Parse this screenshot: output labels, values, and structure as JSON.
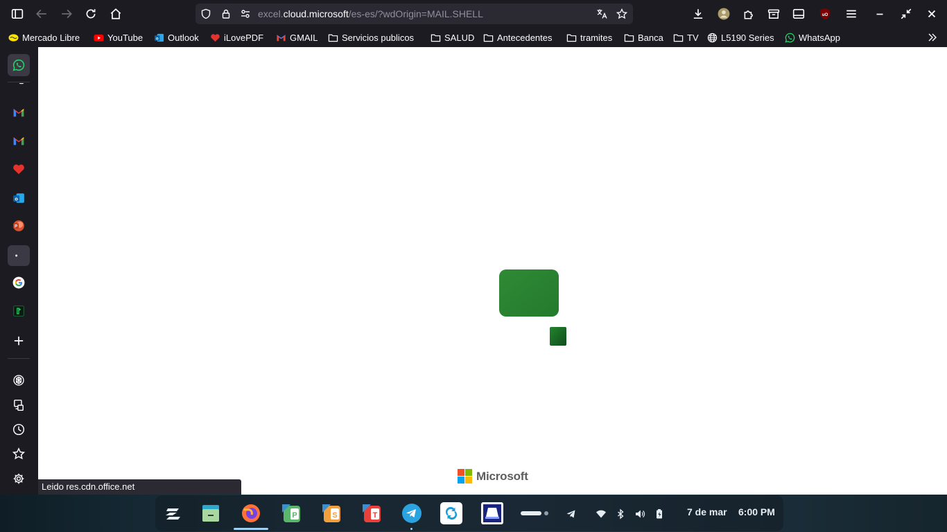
{
  "browser": {
    "url_scheme_host_prefix": "excel.",
    "url_host": "cloud.microsoft",
    "url_path": "/es-es/?wdOrigin=MAIL.SHELL"
  },
  "bookmarks": [
    {
      "label": "Mercado Libre",
      "icon": "mercadolibre-icon"
    },
    {
      "label": "YouTube",
      "icon": "youtube-icon"
    },
    {
      "label": "Outlook",
      "icon": "outlook-icon"
    },
    {
      "label": "iLovePDF",
      "icon": "ilovepdf-icon"
    },
    {
      "label": "GMAIL",
      "icon": "gmail-icon"
    },
    {
      "label": "Servicios publicos",
      "icon": "folder-icon"
    },
    {
      "label": "SALUD",
      "icon": "folder-icon"
    },
    {
      "label": "Antecedentes",
      "icon": "folder-icon"
    },
    {
      "label": "tramites",
      "icon": "folder-icon"
    },
    {
      "label": "Banca",
      "icon": "folder-icon"
    },
    {
      "label": "TV",
      "icon": "folder-icon"
    },
    {
      "label": "L5190 Series",
      "icon": "globe-icon"
    },
    {
      "label": "WhatsApp",
      "icon": "whatsapp-icon"
    }
  ],
  "content": {
    "status_text": "Leido res.cdn.office.net",
    "brand": "Microsoft"
  },
  "taskbar": {
    "date": "7 de mar",
    "time": "6:00 PM"
  },
  "colors": {
    "excel_green": "#2e8b34",
    "excel_green_dark": "#1d6b2a",
    "accent_blue": "#3aa0f7"
  }
}
